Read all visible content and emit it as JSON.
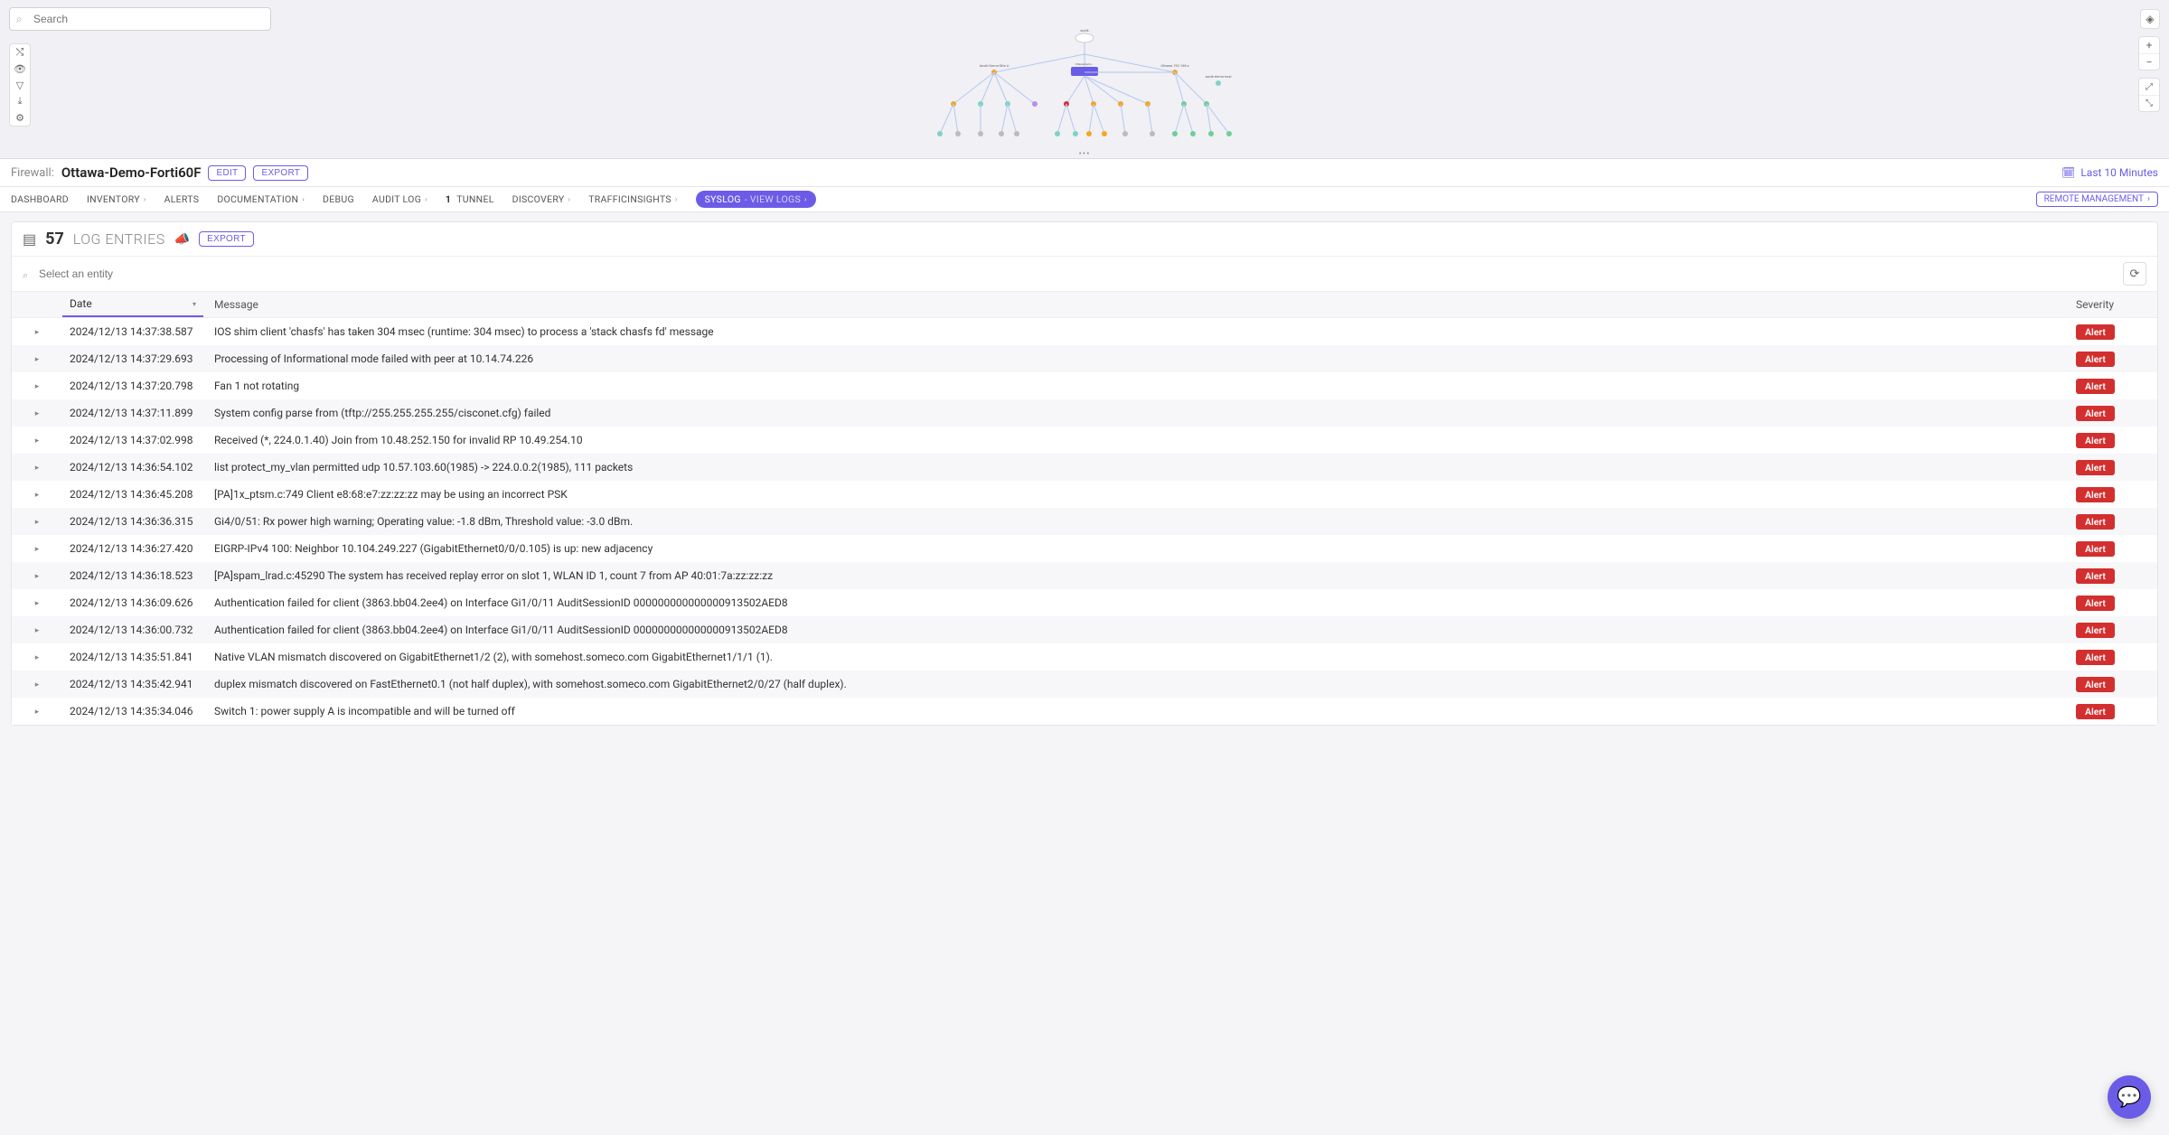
{
  "search": {
    "placeholder": "Search"
  },
  "header": {
    "device_type": "Firewall:",
    "device_name": "Ottawa-Demo-Forti60F",
    "edit_label": "EDIT",
    "export_label": "EXPORT",
    "time_range_label": "Last 10 Minutes"
  },
  "tabs": {
    "dashboard": "DASHBOARD",
    "inventory": "INVENTORY",
    "alerts": "ALERTS",
    "documentation": "DOCUMENTATION",
    "debug": "DEBUG",
    "audit_log": "AUDIT LOG",
    "tunnel_count": "1",
    "tunnel_label": "TUNNEL",
    "discovery": "DISCOVERY",
    "traffic": "TRAFFICINSIGHTS",
    "syslog_main": "SYSLOG",
    "syslog_sub": " - VIEW LOGS",
    "remote_mgmt": "REMOTE MANAGEMENT"
  },
  "entries": {
    "count": "57",
    "label": "LOG ENTRIES",
    "export_label": "EXPORT",
    "filter_placeholder": "Select an entity",
    "columns": {
      "date": "Date",
      "message": "Message",
      "severity": "Severity"
    }
  },
  "severity_label": "Alert",
  "rows": [
    {
      "date": "2024/12/13 14:37:38.587",
      "message": "IOS shim client 'chasfs' has taken 304 msec (runtime: 304 msec) to process a 'stack chasfs fd' message"
    },
    {
      "date": "2024/12/13 14:37:29.693",
      "message": "Processing of Informational mode failed with peer at 10.14.74.226"
    },
    {
      "date": "2024/12/13 14:37:20.798",
      "message": "Fan 1 not rotating"
    },
    {
      "date": "2024/12/13 14:37:11.899",
      "message": "System config parse from (tftp://255.255.255.255/cisconet.cfg) failed"
    },
    {
      "date": "2024/12/13 14:37:02.998",
      "message": "Received (*, 224.0.1.40) Join from 10.48.252.150 for invalid RP 10.49.254.10"
    },
    {
      "date": "2024/12/13 14:36:54.102",
      "message": "list protect_my_vlan permitted udp 10.57.103.60(1985) -> 224.0.0.2(1985), 111 packets"
    },
    {
      "date": "2024/12/13 14:36:45.208",
      "message": "[PA]1x_ptsm.c:749 Client e8:68:e7:zz:zz:zz may be using an incorrect PSK"
    },
    {
      "date": "2024/12/13 14:36:36.315",
      "message": "Gi4/0/51: Rx power high warning; Operating value: -1.8 dBm, Threshold value: -3.0 dBm."
    },
    {
      "date": "2024/12/13 14:36:27.420",
      "message": "EIGRP-IPv4 100: Neighbor 10.104.249.227 (GigabitEthernet0/0/0.105) is up: new adjacency"
    },
    {
      "date": "2024/12/13 14:36:18.523",
      "message": "[PA]spam_lrad.c:45290 The system has received replay error on slot 1, WLAN ID 1, count 7 from AP 40:01:7a:zz:zz:zz"
    },
    {
      "date": "2024/12/13 14:36:09.626",
      "message": "Authentication failed for client (3863.bb04.2ee4) on Interface Gi1/0/11 AuditSessionID 000000000000000913502AED8"
    },
    {
      "date": "2024/12/13 14:36:00.732",
      "message": "Authentication failed for client (3863.bb04.2ee4) on Interface Gi1/0/11 AuditSessionID 000000000000000913502AED8"
    },
    {
      "date": "2024/12/13 14:35:51.841",
      "message": "Native VLAN mismatch discovered on GigabitEthernet1/2 (2), with somehost.someco.com GigabitEthernet1/1/1 (1)."
    },
    {
      "date": "2024/12/13 14:35:42.941",
      "message": "duplex mismatch discovered on FastEthernet0.1 (not half duplex), with somehost.someco.com GigabitEthernet2/0/27 (half duplex)."
    },
    {
      "date": "2024/12/13 14:35:34.046",
      "message": "Switch 1: power supply A is incompatible and will be turned off"
    }
  ]
}
